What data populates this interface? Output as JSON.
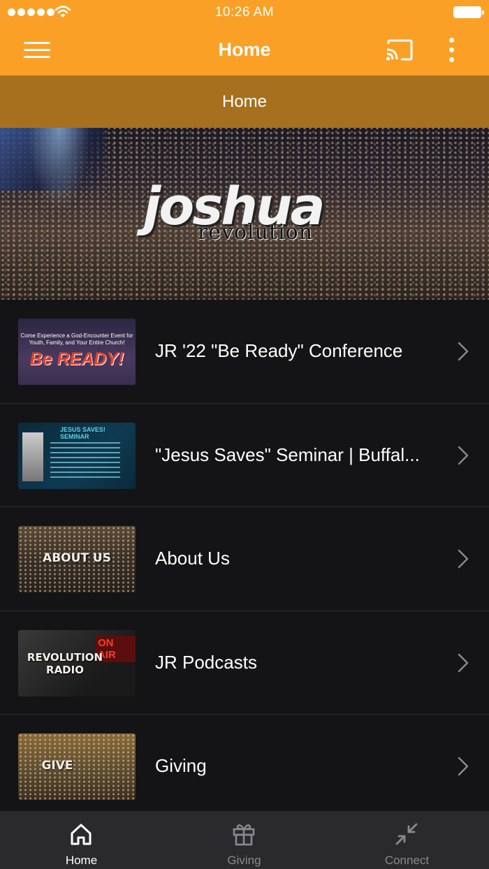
{
  "status_bar": {
    "time": "10:26 AM"
  },
  "nav": {
    "title": "Home"
  },
  "sub_header": {
    "title": "Home"
  },
  "hero": {
    "logo_main": "joshua",
    "logo_sub": "revolution"
  },
  "list": [
    {
      "label": "JR '22 \"Be Ready\" Conference",
      "thumb_line1": "Come Experience a God-Encounter Event for Youth, Family, and Your Entire Church!",
      "thumb_line2": "Be READY!"
    },
    {
      "label": "\"Jesus Saves\" Seminar | Buffal...",
      "thumb_line1": "JESUS SAVES! SEMINAR"
    },
    {
      "label": "About Us",
      "thumb_line1": "ABOUT US"
    },
    {
      "label": "JR Podcasts",
      "thumb_line1": "REVOLUTION RADIO",
      "thumb_line2": "ON AIR"
    },
    {
      "label": "Giving",
      "thumb_line1": "GIVE"
    }
  ],
  "tabs": [
    {
      "label": "Home",
      "icon": "home-icon",
      "active": true
    },
    {
      "label": "Giving",
      "icon": "gift-icon",
      "active": false
    },
    {
      "label": "Connect",
      "icon": "collapse-arrows-icon",
      "active": false
    }
  ],
  "colors": {
    "accent": "#fba026",
    "sub_header": "#a6701f",
    "background": "#141416",
    "tab_bar": "#2a2a2d"
  }
}
